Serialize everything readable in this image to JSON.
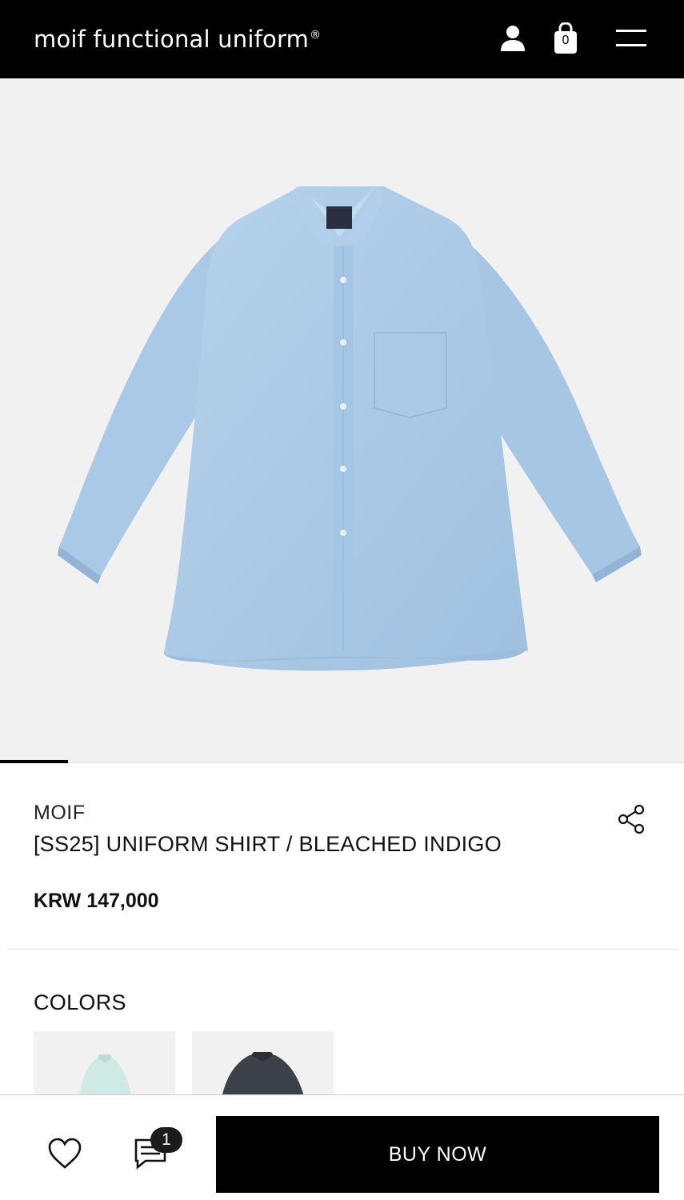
{
  "header": {
    "brand": "moif functional uniform",
    "registered_mark": "®",
    "cart_count": "0",
    "icons": [
      "user-icon",
      "shopping-bag-icon",
      "hamburger-menu-icon"
    ],
    "background": "#000000"
  },
  "hero": {
    "image": "light-blue-shirt-product-photo",
    "slide_index": 1,
    "background": "#f1f1f1"
  },
  "product": {
    "brand": "MOIF",
    "title": "[SS25] UNIFORM SHIRT / BLEACHED INDIGO",
    "price": "KRW 147,000",
    "share_icon": "share-icon"
  },
  "colors": {
    "label": "COLORS",
    "swatches": [
      {
        "name": "mint-shirt-swatch",
        "color": "#cfe9e4"
      },
      {
        "name": "charcoal-shirt-swatch",
        "color": "#3c4048"
      }
    ]
  },
  "bottom_bar": {
    "wishlist_icon": "heart-icon",
    "chat_icon": "chat-icon",
    "chat_badge": "1",
    "buy_label": "BUY NOW"
  }
}
